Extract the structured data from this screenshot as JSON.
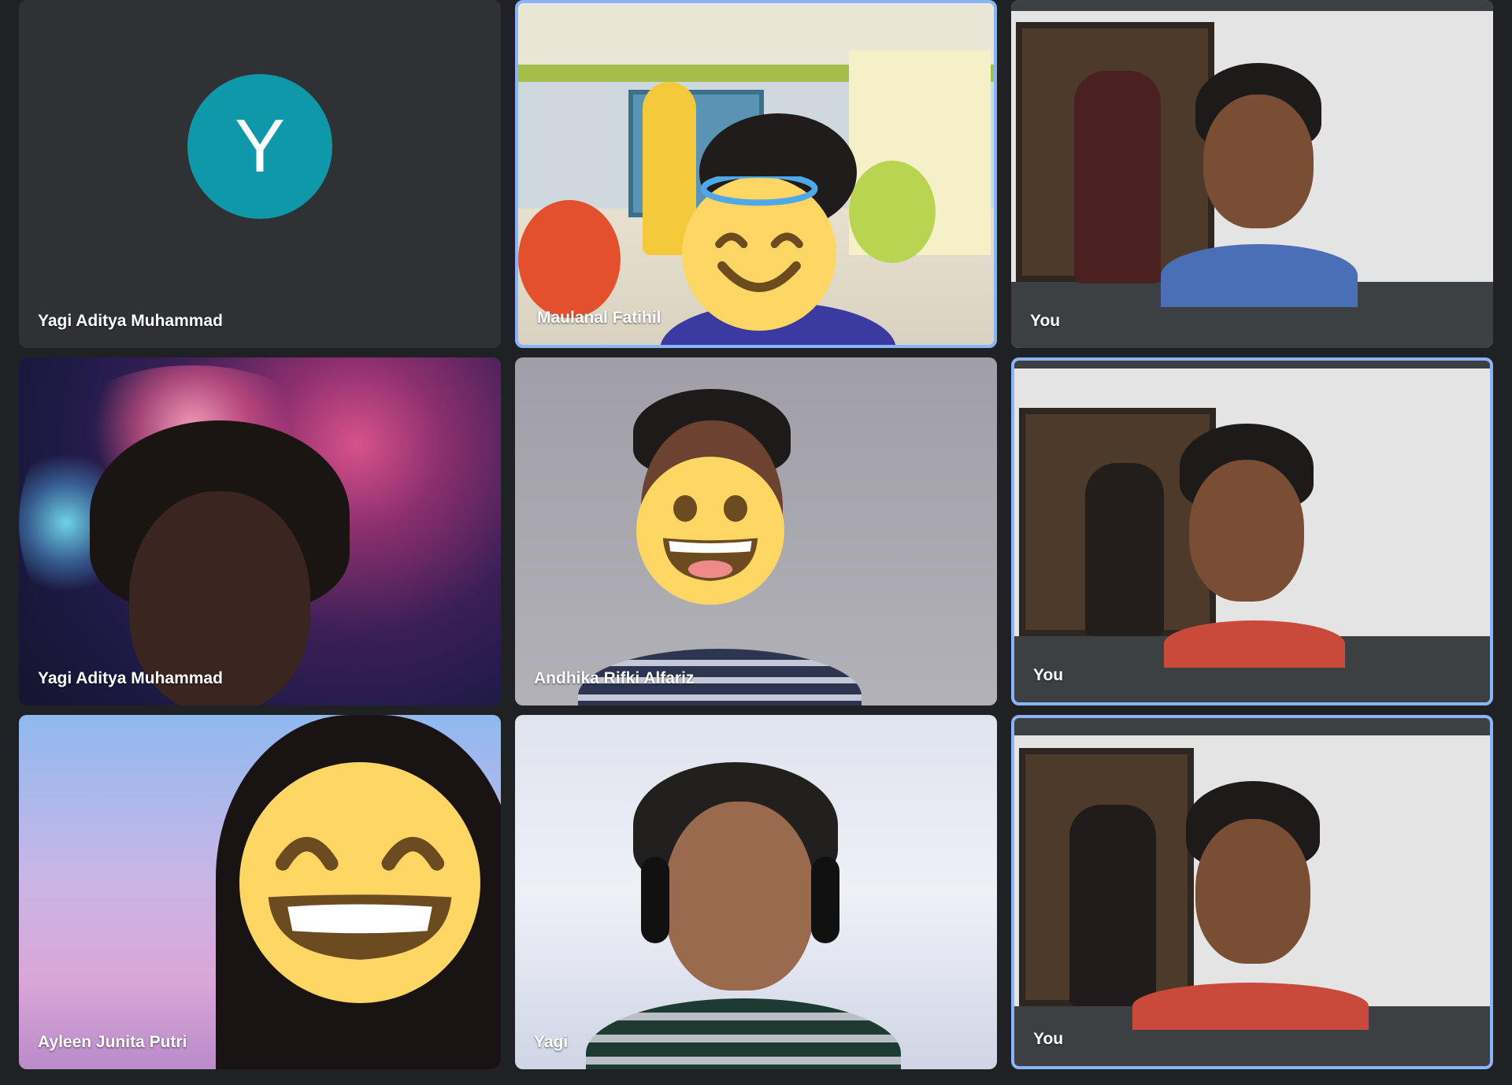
{
  "meeting": {
    "tiles": [
      {
        "name": "Yagi Aditya Muhammad",
        "avatar_letter": "Y",
        "avatar_color": "#0e98a8",
        "camera": "off"
      },
      {
        "name": "Maulanal Fatihil",
        "emoji": "smiling-face-with-halo",
        "active": true
      },
      {
        "name": "You",
        "camera": "on"
      },
      {
        "name": "Yagi Aditya Muhammad",
        "background": "fireworks"
      },
      {
        "name": "Andhika Rifki Alfariz",
        "emoji": "grinning-face"
      },
      {
        "name": "You",
        "active": true
      },
      {
        "name": "Ayleen Junita Putri",
        "emoji": "grinning-face-with-smiling-eyes"
      },
      {
        "name": "Yagi",
        "headset": true
      },
      {
        "name": "You",
        "active": true
      }
    ]
  },
  "colors": {
    "background": "#202124",
    "tile": "#3c4043",
    "active_border": "#8ab4f8",
    "emoji_yellow": "#fdd663"
  }
}
